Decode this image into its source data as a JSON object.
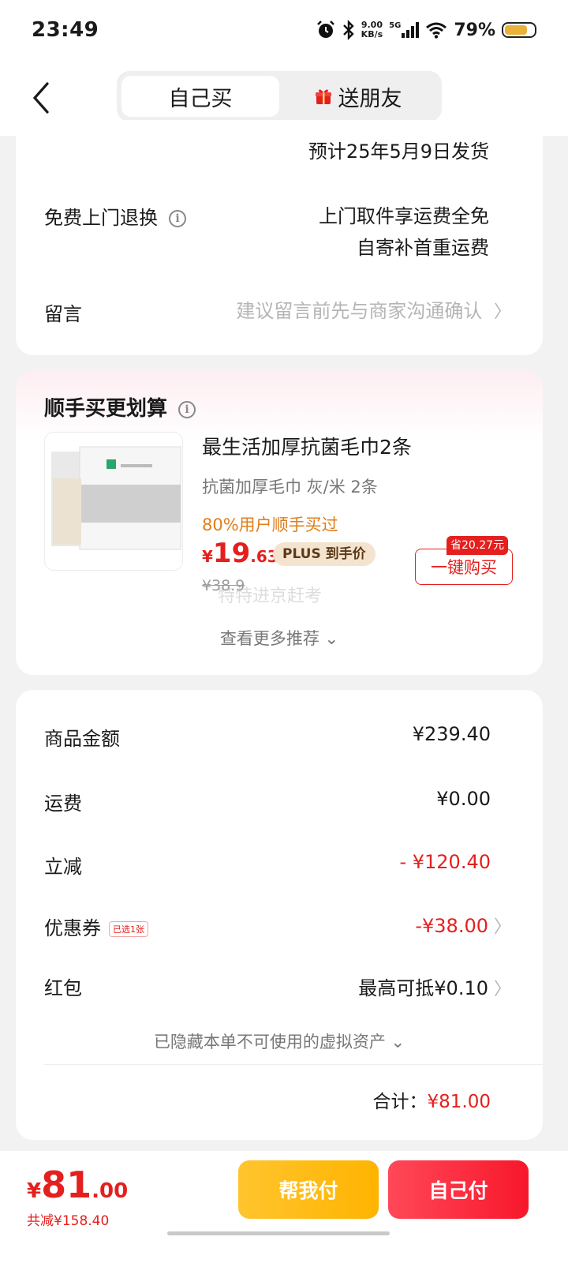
{
  "status_bar": {
    "time": "23:49",
    "net_speed_top": "9.00",
    "net_speed_bottom": "KB/s",
    "network": "5G",
    "battery": "79%",
    "battery_level": 0.79
  },
  "header": {
    "tabs": [
      {
        "label": "自己买",
        "active": true
      },
      {
        "label": "送朋友",
        "active": false
      }
    ]
  },
  "delivery": {
    "ship_date": "预计25年5月9日发货",
    "return_label": "免费上门退换",
    "return_value_line1": "上门取件享运费全免",
    "return_value_line2": "自寄补首重运费",
    "message_label": "留言",
    "message_placeholder": "建议留言前先与商家沟通确认"
  },
  "recommend": {
    "title": "顺手买更划算",
    "product": {
      "name": "最生活加厚抗菌毛巾2条",
      "spec": "抗菌加厚毛巾 灰/米 2条",
      "hint": "80%用户顺手买过",
      "price_yen": "¥",
      "price_int": "19",
      "price_dec": ".63",
      "plus_label": "PLUS 到手价",
      "orig_price": "¥38.9",
      "save_tag": "省20.27元",
      "buy_label": "一键购买"
    },
    "watermark": "特特进京赶考",
    "more_label": "查看更多推荐 ⌄"
  },
  "summary": {
    "rows": [
      {
        "label": "商品金额",
        "value": "¥239.40"
      },
      {
        "label": "运费",
        "value": "¥0.00"
      },
      {
        "label": "立减",
        "value": "- ¥120.40"
      },
      {
        "label": "优惠券",
        "tag": "已选1张",
        "value": "-¥38.00"
      },
      {
        "label": "红包",
        "value": "最高可抵¥0.10"
      }
    ],
    "hidden_note": "已隐藏本单不可使用的虚拟资产 ⌄",
    "total_label": "合计：",
    "total_value": "¥81.00"
  },
  "bottom": {
    "price_yen": "¥",
    "price_int": "81",
    "price_dec": ".00",
    "saved": "共减¥158.40",
    "help_pay_label": "帮我付",
    "self_pay_label": "自己付"
  },
  "colors": {
    "accent_red": "#e4201e",
    "hint_orange": "#e07d1a",
    "help_btn": "#ffb400",
    "self_btn": "#f8172b"
  }
}
